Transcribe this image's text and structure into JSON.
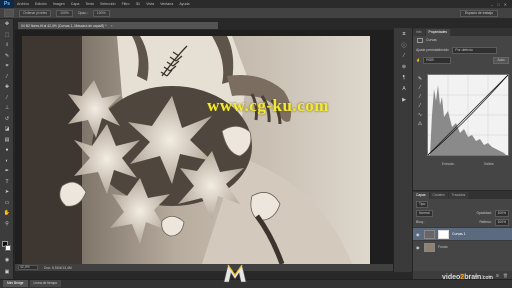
{
  "app": {
    "logo": "Ps"
  },
  "menu": {
    "items": [
      "Archivo",
      "Edición",
      "Imagen",
      "Capa",
      "Texto",
      "Selección",
      "Filtro",
      "3D",
      "Vista",
      "Ventana",
      "Ayuda"
    ]
  },
  "window_controls": {
    "minimize": "–",
    "maximize": "□",
    "close": "✕"
  },
  "options_bar": {
    "mode_label": "Ordenar píxeles",
    "opacity_label": "Opac.:",
    "opacity_value": "100%",
    "size_value": "100%",
    "workspace": "Espacio de trabajo"
  },
  "document": {
    "tab_title": "04 B2 flores.tif al 42,4% (Curvas 1, Máscara de capa/8) *",
    "close": "×"
  },
  "watermark": "www.cg-ku.com",
  "status": {
    "zoom": "42,4%",
    "doc": "Doc: 5,91M/13,4M"
  },
  "timeline": {
    "tabs": [
      "Mini Bridge",
      "Línea de tiempo"
    ]
  },
  "properties": {
    "tabs": [
      "Info",
      "Propiedades"
    ],
    "header": "Curvas",
    "preset_label": "Ajuste preestablecido:",
    "preset_value": "Por defecto",
    "channel_value": "RGB",
    "auto_label": "Auto",
    "input_label": "Entrada:",
    "output_label": "Salida:"
  },
  "layers": {
    "tabs": [
      "Capas",
      "Canales",
      "Trazados"
    ],
    "kind_value": "Tipo",
    "blend_value": "Normal",
    "opacity_label": "Opacidad:",
    "opacity_value": "100%",
    "fill_label": "Relleno:",
    "fill_value": "100%",
    "lock_label": "Bloq.:",
    "items": [
      {
        "name": "Curvas 1",
        "active": true
      },
      {
        "name": "Fondo",
        "active": false
      }
    ]
  },
  "branding": {
    "video": "video",
    "two": "2",
    "brain": "brain",
    "com": ".com"
  },
  "icons": [
    "move-icon",
    "marquee-icon",
    "lasso-icon",
    "quick-select-icon",
    "crop-icon",
    "eyedropper-icon",
    "healing-icon",
    "brush-icon",
    "stamp-icon",
    "history-brush-icon",
    "eraser-icon",
    "gradient-icon",
    "blur-icon",
    "dodge-icon",
    "pen-icon",
    "type-icon",
    "path-select-icon",
    "shape-icon",
    "hand-icon",
    "zoom-icon"
  ],
  "colors": {
    "accent_selected": "#5b6a7e",
    "watermark": "#f2ea36",
    "logo_orange": "#f39a1e"
  }
}
